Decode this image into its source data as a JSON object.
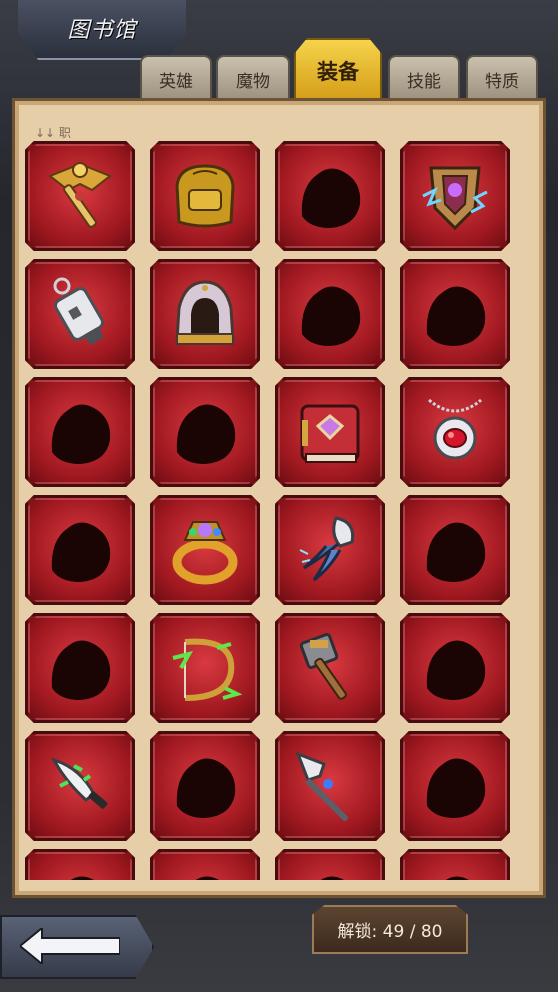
{
  "window": {
    "title": "图书馆"
  },
  "tabs": [
    {
      "label": "英雄",
      "active": false
    },
    {
      "label": "魔物",
      "active": false
    },
    {
      "label": "装备",
      "active": true
    },
    {
      "label": "技能",
      "active": false
    },
    {
      "label": "特质",
      "active": false
    }
  ],
  "panel": {
    "subhead": "↓↓ 职"
  },
  "items": [
    {
      "name": "winged-cross-staff",
      "unlocked": true
    },
    {
      "name": "gold-backpack",
      "unlocked": true
    },
    {
      "name": "locked-item",
      "unlocked": false
    },
    {
      "name": "lightning-shield",
      "unlocked": true
    },
    {
      "name": "lantern",
      "unlocked": true
    },
    {
      "name": "hooded-helmet",
      "unlocked": true
    },
    {
      "name": "locked-item",
      "unlocked": false
    },
    {
      "name": "locked-item",
      "unlocked": false
    },
    {
      "name": "locked-item",
      "unlocked": false
    },
    {
      "name": "locked-item",
      "unlocked": false
    },
    {
      "name": "spell-book",
      "unlocked": true
    },
    {
      "name": "ruby-amulet",
      "unlocked": true
    },
    {
      "name": "locked-item",
      "unlocked": false
    },
    {
      "name": "jeweled-ring",
      "unlocked": true
    },
    {
      "name": "claw-gauntlet",
      "unlocked": true
    },
    {
      "name": "locked-item",
      "unlocked": false
    },
    {
      "name": "locked-item",
      "unlocked": false
    },
    {
      "name": "thorn-bow",
      "unlocked": true
    },
    {
      "name": "war-hammer",
      "unlocked": true
    },
    {
      "name": "locked-item",
      "unlocked": false
    },
    {
      "name": "poison-dagger",
      "unlocked": true
    },
    {
      "name": "locked-item",
      "unlocked": false
    },
    {
      "name": "crystal-spear",
      "unlocked": true
    },
    {
      "name": "locked-item",
      "unlocked": false
    },
    {
      "name": "locked-item",
      "unlocked": false
    },
    {
      "name": "locked-item",
      "unlocked": false
    },
    {
      "name": "locked-item",
      "unlocked": false
    },
    {
      "name": "locked-item",
      "unlocked": false
    }
  ],
  "footer": {
    "back_icon": "back-arrow-icon",
    "unlock_label": "解锁: 49 / 80"
  }
}
